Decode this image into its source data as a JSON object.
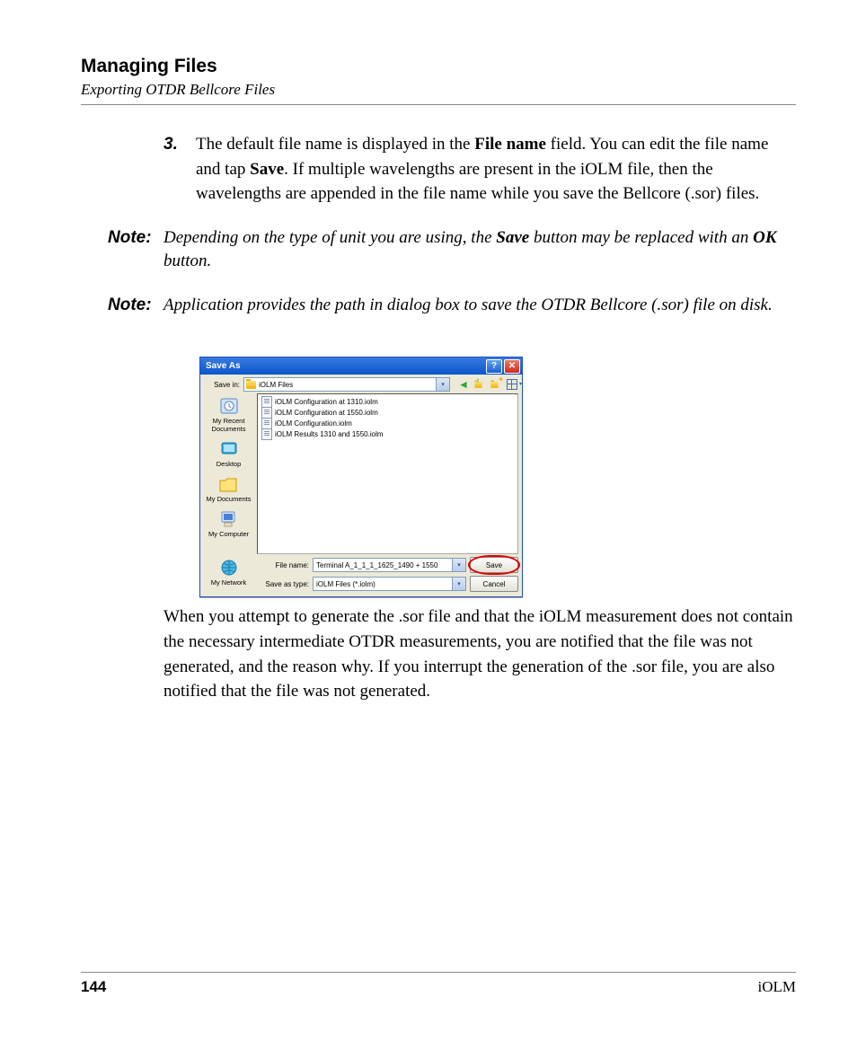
{
  "header": {
    "title": "Managing Files",
    "subtitle": "Exporting OTDR Bellcore Files"
  },
  "step": {
    "number": "3.",
    "prefix": "The default file name is displayed in the ",
    "bold1": "File name",
    "mid1": " field. You can edit the file name and tap ",
    "bold2": "Save",
    "suffix": ". If multiple wavelengths are present in the iOLM file, then the wavelengths are appended in the file name while you save the Bellcore (.sor) files."
  },
  "note1": {
    "label": "Note:",
    "t1": "Depending on the type of unit you are using, the ",
    "b1": "Save",
    "t2": " button may be replaced with an ",
    "b2": "OK",
    "t3": " button."
  },
  "note2": {
    "label": "Note:",
    "text": "Application provides the path in dialog box to save the OTDR Bellcore (.sor) file on disk."
  },
  "dialog": {
    "title": "Save As",
    "help_symbol": "?",
    "close_symbol": "✕",
    "savein_label": "Save in:",
    "savein_value": "iOLM Files",
    "places": {
      "recent": "My Recent Documents",
      "desktop": "Desktop",
      "docs": "My Documents",
      "computer": "My Computer",
      "network": "My Network"
    },
    "files": [
      "iOLM Configuration at 1310.iolm",
      "iOLM Configuration at 1550.iolm",
      "iOLM Configuration.iolm",
      "iOLM Results 1310 and 1550.iolm"
    ],
    "filename_label": "File name:",
    "filename_value": "Terminal A_1_1_1_1625_1490 + 1550",
    "filetype_label": "Save as type:",
    "filetype_value": "iOLM Files (*.iolm)",
    "save_btn": "Save",
    "cancel_btn": "Cancel"
  },
  "paragraph": "When you attempt to generate the .sor file and that the iOLM measurement does not contain the necessary intermediate OTDR measurements, you are notified that the file was not generated, and the reason why. If you interrupt the generation of the .sor file, you are also notified that the file was not generated.",
  "footer": {
    "page": "144",
    "product": "iOLM"
  }
}
